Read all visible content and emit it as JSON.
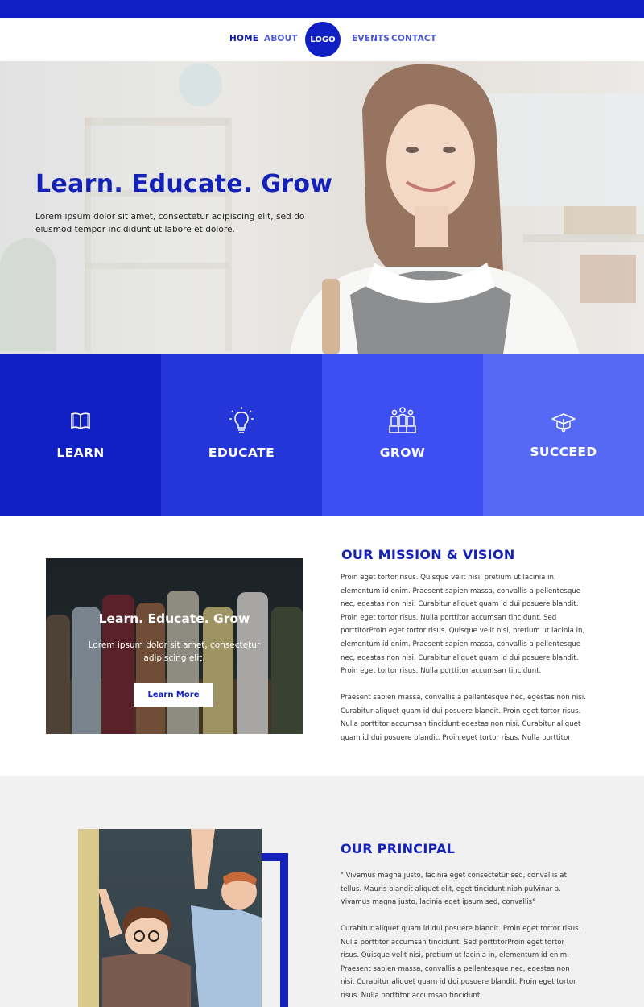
{
  "nav": {
    "links": [
      "HOME",
      "ABOUT",
      "EVENTS",
      "CONTACT"
    ],
    "active": "HOME",
    "logo": "LOGO"
  },
  "hero": {
    "title": "Learn. Educate. Grow",
    "lead": "Lorem ipsum dolor sit amet, consectetur adipiscing elit, sed do eiusmod tempor incididunt ut labore et dolore."
  },
  "features": [
    {
      "label": "LEARN",
      "icon": "book-icon",
      "color": "#1020c4"
    },
    {
      "label": "EDUCATE",
      "icon": "lightbulb-icon",
      "color": "#2536d8"
    },
    {
      "label": "GROW",
      "icon": "people-podium-icon",
      "color": "#3d4ff2"
    },
    {
      "label": "SUCCEED",
      "icon": "graduation-cap-icon",
      "color": "#5569f4"
    }
  ],
  "mission": {
    "card_title": "Learn. Educate. Grow",
    "card_text": "Lorem ipsum dolor sit amet, consectetur adipiscing elit.",
    "card_button": "Learn More",
    "title": "OUR MISSION & VISION",
    "para1": "Proin eget tortor risus. Quisque velit nisi, pretium ut lacinia in, elementum id enim. Praesent sapien massa, convallis a pellentesque nec, egestas non nisi. Curabitur aliquet quam id dui posuere blandit. Proin eget tortor risus. Nulla porttitor accumsan tincidunt. Sed porttitorProin eget tortor risus. Quisque velit nisi, pretium ut lacinia in, elementum id enim. Praesent sapien massa, convallis a pellentesque nec, egestas non nisi. Curabitur aliquet quam id dui posuere blandit. Proin eget tortor risus. Nulla porttitor accumsan tincidunt.",
    "para2": "Praesent sapien massa, convallis a pellentesque nec, egestas non nisi. Curabitur aliquet quam id dui posuere blandit. Proin eget tortor risus. Nulla porttitor accumsan tincidunt egestas non nisi. Curabitur aliquet quam id dui posuere blandit. Proin eget tortor risus. Nulla porttitor"
  },
  "principal": {
    "title": "OUR PRINCIPAL",
    "quote": "\" Vivamus magna justo, lacinia eget consectetur sed, convallis at tellus. Mauris blandit aliquet elit, eget tincidunt nibh pulvinar a. Vivamus magna justo, lacinia eget ipsum sed, convallis\"",
    "para": "Curabitur aliquet quam id dui posuere blandit. Proin eget tortor risus. Nulla porttitor accumsan tincidunt. Sed porttitorProin eget tortor risus. Quisque velit nisi, pretium ut lacinia in, elementum id enim. Praesent sapien massa, convallis a pellentesque nec, egestas non nisi. Curabitur aliquet quam id dui posuere blandit. Proin eget tortor risus. Nulla porttitor accumsan tincidunt."
  }
}
